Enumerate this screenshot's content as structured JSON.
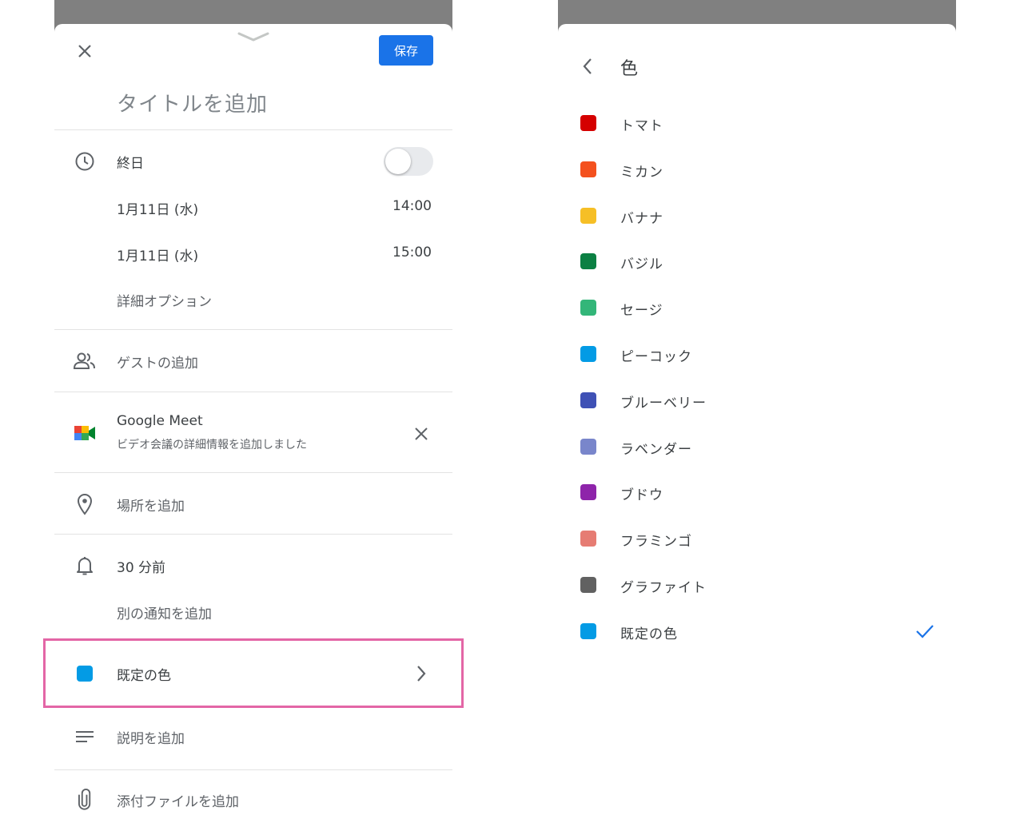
{
  "event_editor": {
    "save_label": "保存",
    "title_placeholder": "タイトルを追加",
    "all_day_label": "終日",
    "all_day_enabled": false,
    "start_date": "1月11日 (水)",
    "start_time": "14:00",
    "end_date": "1月11日 (水)",
    "end_time": "15:00",
    "more_options": "詳細オプション",
    "add_guests": "ゲストの追加",
    "meet_title": "Google Meet",
    "meet_subtitle": "ビデオ会議の詳細情報を追加しました",
    "add_location": "場所を追加",
    "notification": "30 分前",
    "add_notification": "別の通知を追加",
    "color_label": "既定の色",
    "color_swatch": "#039be5",
    "add_description": "説明を追加",
    "add_attachment": "添付ファイルを追加",
    "icons": [
      "close-icon",
      "drag-handle-icon",
      "clock-icon",
      "people-icon",
      "google-meet-icon",
      "location-pin-icon",
      "bell-icon",
      "notes-icon",
      "paperclip-icon",
      "chevron-right-icon"
    ]
  },
  "color_picker": {
    "title": "色",
    "selected": "既定の色",
    "colors": [
      {
        "label": "トマト",
        "hex": "#d50000"
      },
      {
        "label": "ミカン",
        "hex": "#f4511e"
      },
      {
        "label": "バナナ",
        "hex": "#f6bf26"
      },
      {
        "label": "バジル",
        "hex": "#0b8043"
      },
      {
        "label": "セージ",
        "hex": "#33b679"
      },
      {
        "label": "ピーコック",
        "hex": "#039be5"
      },
      {
        "label": "ブルーベリー",
        "hex": "#3f51b5"
      },
      {
        "label": "ラベンダー",
        "hex": "#7986cb"
      },
      {
        "label": "ブドウ",
        "hex": "#8e24aa"
      },
      {
        "label": "フラミンゴ",
        "hex": "#e67c73"
      },
      {
        "label": "グラファイト",
        "hex": "#616161"
      },
      {
        "label": "既定の色",
        "hex": "#039be5"
      }
    ]
  },
  "accent_color": "#1a73e8",
  "highlight_color": "#e366a6"
}
